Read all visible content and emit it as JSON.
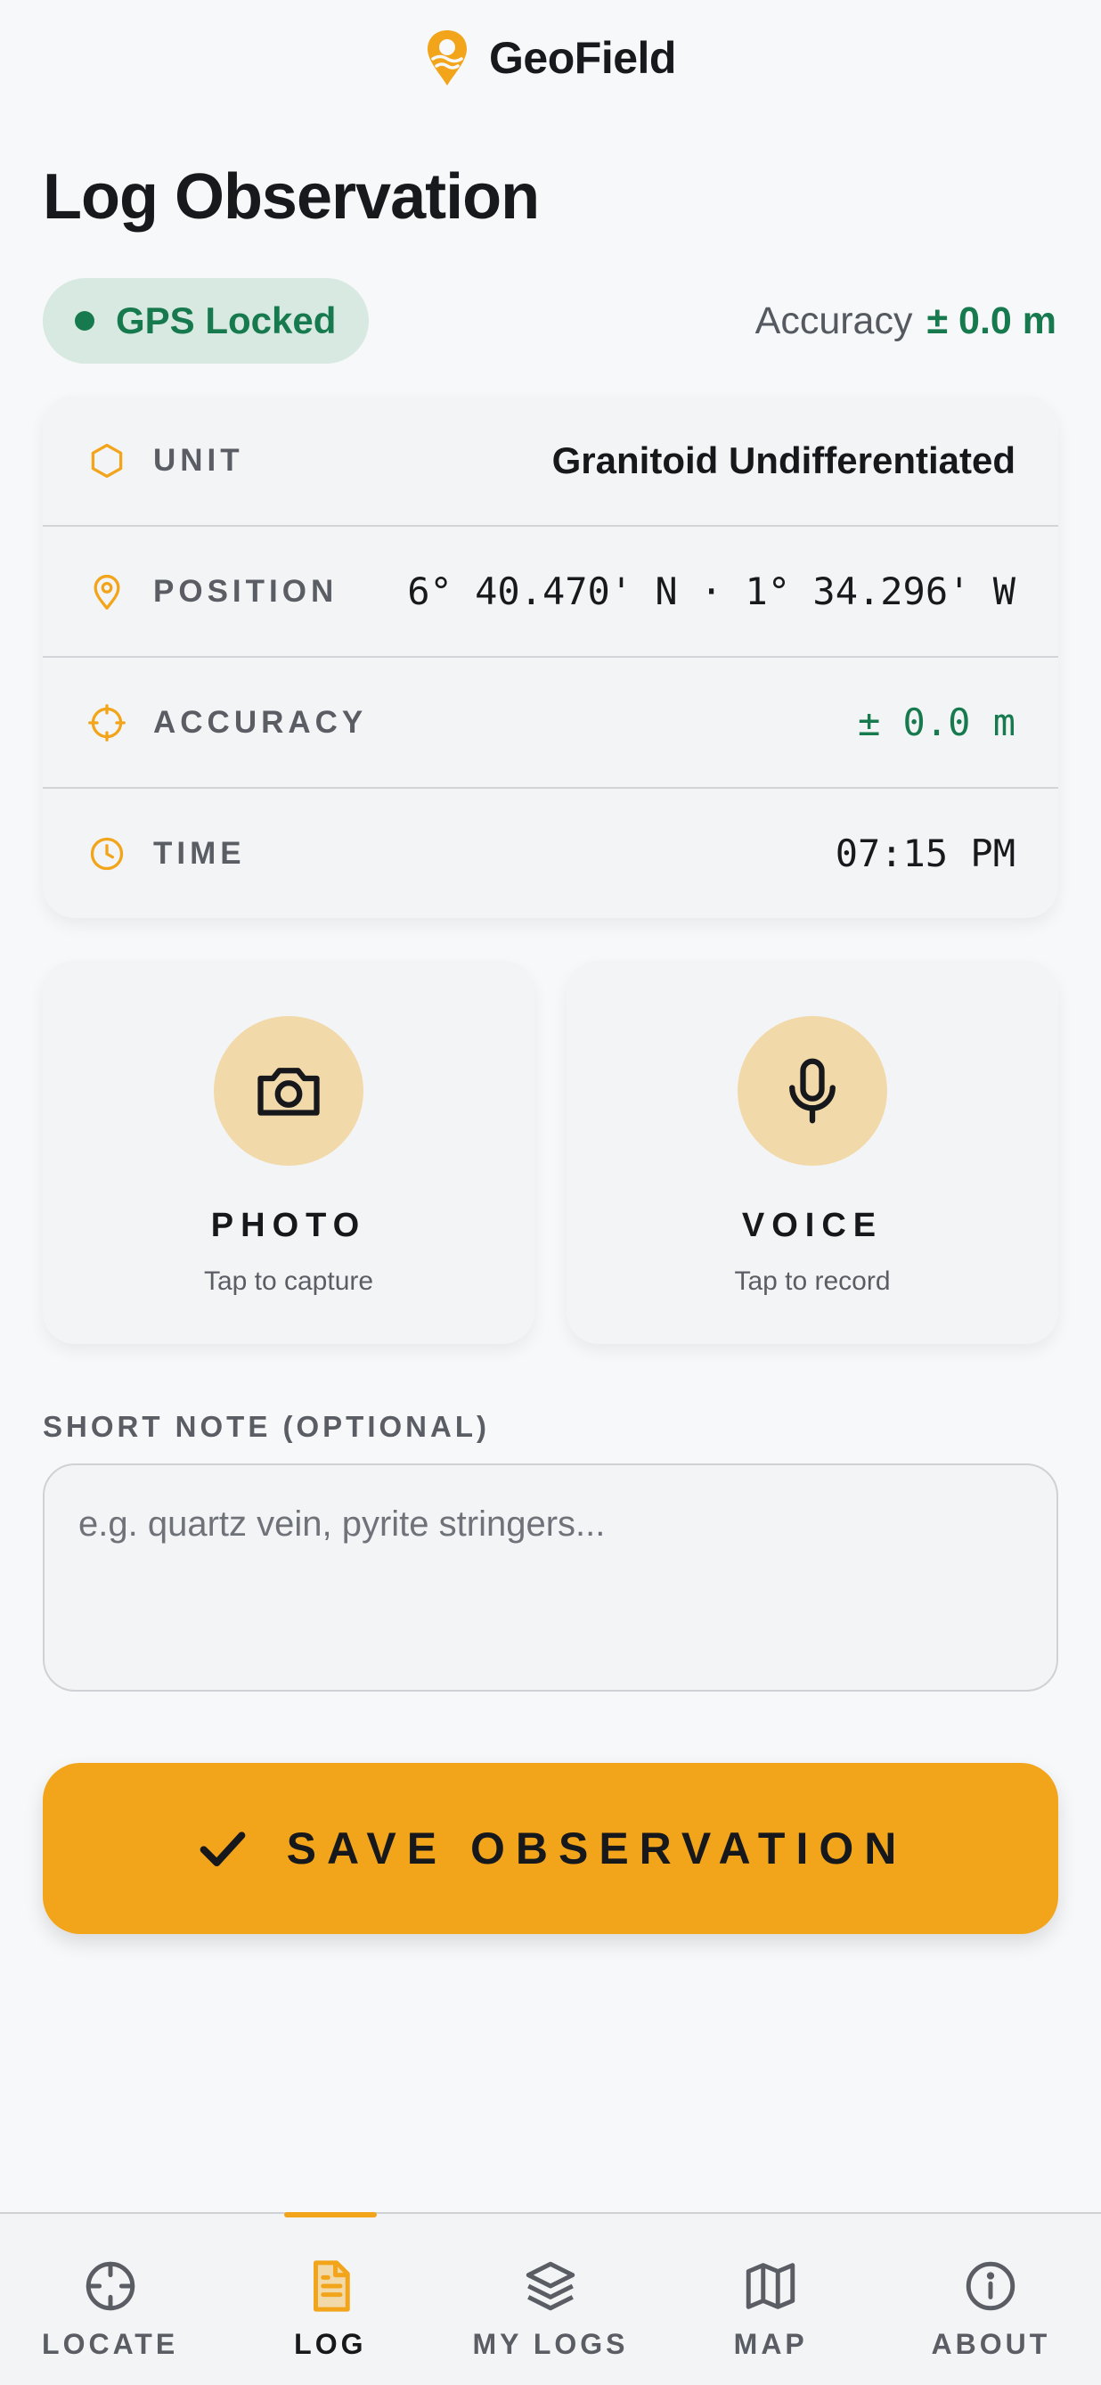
{
  "app": {
    "name": "GeoField",
    "logo_icon": "map-pin-logo-icon"
  },
  "page": {
    "title": "Log Observation"
  },
  "status": {
    "gps_label": "GPS Locked",
    "accuracy_label": "Accuracy",
    "accuracy_value": "± 0.0 m",
    "color": "#177a4e"
  },
  "info": {
    "rows": [
      {
        "icon": "hexagon-icon",
        "label": "UNIT",
        "value": "Granitoid Undifferentiated"
      },
      {
        "icon": "map-pin-icon",
        "label": "POSITION",
        "value": "6° 40.470' N · 1° 34.296' W"
      },
      {
        "icon": "crosshair-icon",
        "label": "ACCURACY",
        "value": "± 0.0 m"
      },
      {
        "icon": "clock-icon",
        "label": "TIME",
        "value": "07:15 PM"
      }
    ]
  },
  "capture": {
    "photo": {
      "icon": "camera-icon",
      "title": "PHOTO",
      "subtitle": "Tap to capture"
    },
    "voice": {
      "icon": "microphone-icon",
      "title": "VOICE",
      "subtitle": "Tap to record"
    }
  },
  "note": {
    "label": "SHORT NOTE (OPTIONAL)",
    "placeholder": "e.g. quartz vein, pyrite stringers...",
    "value": ""
  },
  "save": {
    "label": "SAVE OBSERVATION",
    "icon": "checkmark-icon"
  },
  "nav": {
    "active": "LOG",
    "items": [
      {
        "label": "LOCATE",
        "icon": "crosshair-icon"
      },
      {
        "label": "LOG",
        "icon": "document-icon"
      },
      {
        "label": "MY LOGS",
        "icon": "layers-icon"
      },
      {
        "label": "MAP",
        "icon": "map-icon"
      },
      {
        "label": "ABOUT",
        "icon": "info-icon"
      }
    ]
  },
  "colors": {
    "accent": "#f2a51a",
    "accent_soft": "#f2d9aa",
    "success": "#177a4e",
    "background": "#f7f8fa"
  }
}
